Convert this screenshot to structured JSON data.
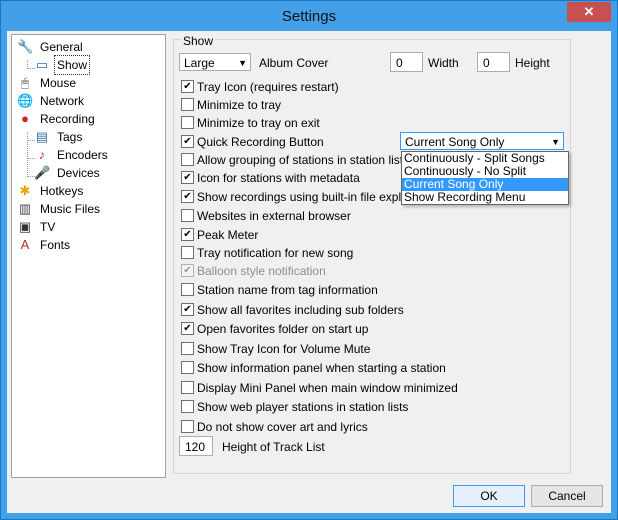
{
  "window": {
    "title": "Settings",
    "close_glyph": "✕"
  },
  "tree": [
    {
      "label": "General",
      "icon": "wrench-icon",
      "glyph": "🔧",
      "color": "#666666"
    },
    {
      "label": "Show",
      "icon": "window-icon",
      "glyph": "▭",
      "color": "#2c6fbd"
    },
    {
      "label": "Mouse",
      "icon": "mouse-icon",
      "glyph": "🖱",
      "color": "#555555"
    },
    {
      "label": "Network",
      "icon": "network-icon",
      "glyph": "🌐",
      "color": "#2a7dd0"
    },
    {
      "label": "Recording",
      "icon": "record-icon",
      "glyph": "●",
      "color": "#d91e18"
    },
    {
      "label": "Tags",
      "icon": "tag-list-icon",
      "glyph": "▤",
      "color": "#3a6ea5"
    },
    {
      "label": "Encoders",
      "icon": "encoder-icon",
      "glyph": "♪",
      "color": "#c0392b"
    },
    {
      "label": "Devices",
      "icon": "microphone-icon",
      "glyph": "🎤",
      "color": "#444444"
    },
    {
      "label": "Hotkeys",
      "icon": "hotkeys-icon",
      "glyph": "✱",
      "color": "#e0a800"
    },
    {
      "label": "Music Files",
      "icon": "music-files-icon",
      "glyph": "▥",
      "color": "#444444"
    },
    {
      "label": "TV",
      "icon": "tv-icon",
      "glyph": "▣",
      "color": "#333333"
    },
    {
      "label": "Fonts",
      "icon": "fonts-icon",
      "glyph": "A",
      "color": "#b03030"
    }
  ],
  "group_label": "Show",
  "album_cover": {
    "size_value": "Large",
    "label": "Album Cover",
    "width_value": "0",
    "width_label": "Width",
    "height_value": "0",
    "height_label": "Height"
  },
  "checkboxes": [
    {
      "label": "Tray Icon (requires restart)",
      "checked": true,
      "disabled": false
    },
    {
      "label": "Minimize to tray",
      "checked": false,
      "disabled": false
    },
    {
      "label": "Minimize to tray on exit",
      "checked": false,
      "disabled": false
    },
    {
      "label": "Quick Recording Button",
      "checked": true,
      "disabled": false
    },
    {
      "label": "Allow grouping of stations in station list",
      "checked": false,
      "disabled": false
    },
    {
      "label": "Icon for stations with metadata",
      "checked": true,
      "disabled": false
    },
    {
      "label": "Show recordings using built-in file explorer",
      "checked": true,
      "disabled": false
    },
    {
      "label": "Websites in external browser",
      "checked": false,
      "disabled": false
    },
    {
      "label": "Peak Meter",
      "checked": true,
      "disabled": false
    },
    {
      "label": "Tray notification for new song",
      "checked": false,
      "disabled": false
    },
    {
      "label": "Balloon style notification",
      "checked": true,
      "disabled": true
    },
    {
      "label": "Station name from tag information",
      "checked": false,
      "disabled": false
    },
    {
      "label": "Show all favorites including sub folders",
      "checked": true,
      "disabled": false
    },
    {
      "label": "Open favorites folder on start up",
      "checked": true,
      "disabled": false
    },
    {
      "label": "Show Tray Icon for Volume Mute",
      "checked": false,
      "disabled": false
    },
    {
      "label": "Show information panel when starting a station",
      "checked": false,
      "disabled": false
    },
    {
      "label": "Display Mini Panel when main window minimized",
      "checked": false,
      "disabled": false
    },
    {
      "label": "Show web player stations in station lists",
      "checked": false,
      "disabled": false
    },
    {
      "label": "Do not show cover art and lyrics",
      "checked": false,
      "disabled": false
    }
  ],
  "quick_recording": {
    "selected": "Current Song Only",
    "options": [
      "Continuously - Split Songs",
      "Continuously - No Split",
      "Current Song Only",
      "Show Recording Menu"
    ],
    "highlighted_index": 2
  },
  "track_list": {
    "value": "120",
    "label": "Height of Track List"
  },
  "buttons": {
    "ok": "OK",
    "cancel": "Cancel"
  }
}
